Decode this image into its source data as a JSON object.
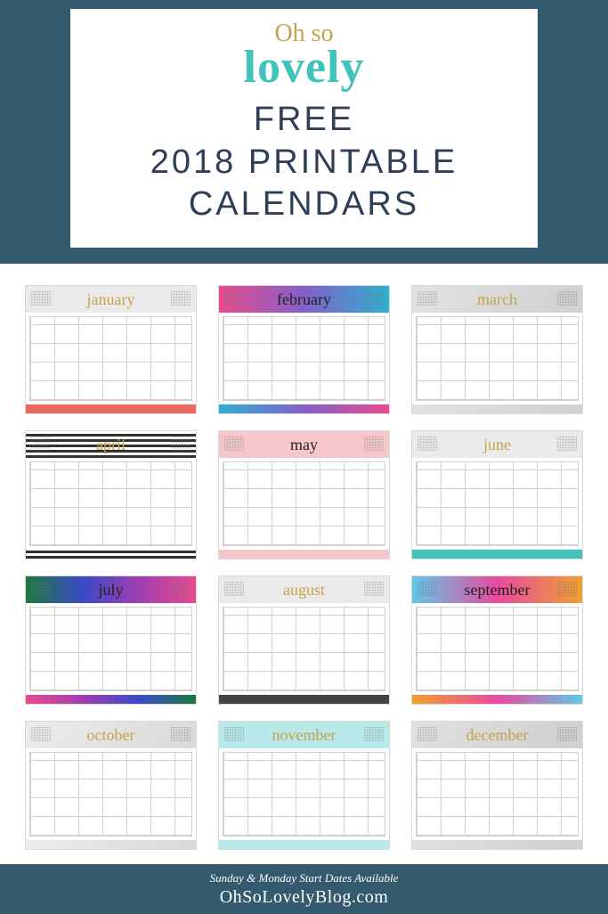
{
  "brand": {
    "script": "Oh so",
    "lovely": "lovely"
  },
  "headline": {
    "line1": "FREE",
    "line2": "2018 PRINTABLE",
    "line3": "CALENDARS"
  },
  "months": [
    {
      "name": "january",
      "cls": "m1",
      "dark": false
    },
    {
      "name": "february",
      "cls": "m2",
      "dark": true
    },
    {
      "name": "march",
      "cls": "m3",
      "dark": false
    },
    {
      "name": "april",
      "cls": "m4",
      "dark": false
    },
    {
      "name": "may",
      "cls": "m5",
      "dark": true
    },
    {
      "name": "june",
      "cls": "m6",
      "dark": false
    },
    {
      "name": "july",
      "cls": "m7",
      "dark": true
    },
    {
      "name": "august",
      "cls": "m8",
      "dark": false
    },
    {
      "name": "september",
      "cls": "m9",
      "dark": true
    },
    {
      "name": "october",
      "cls": "m10",
      "dark": false
    },
    {
      "name": "november",
      "cls": "m11",
      "dark": false
    },
    {
      "name": "december",
      "cls": "m12",
      "dark": false
    }
  ],
  "footer": {
    "note": "Sunday & Monday Start Dates Available",
    "url": "OhSoLovelyBlog.com"
  }
}
